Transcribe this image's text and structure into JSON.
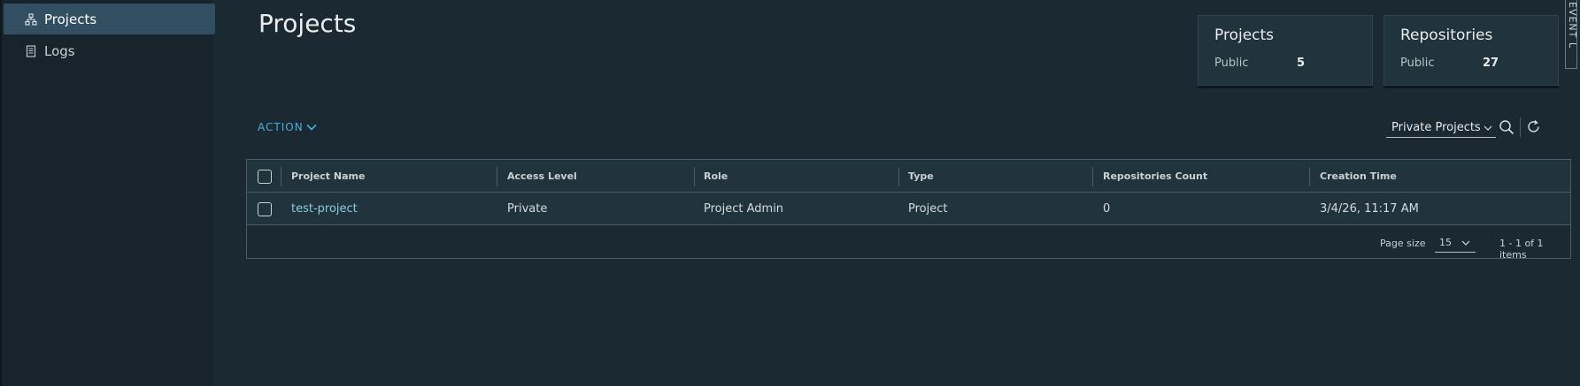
{
  "sidebar": {
    "items": [
      {
        "label": "Projects",
        "icon": "org-chart-icon"
      },
      {
        "label": "Logs",
        "icon": "log-icon"
      }
    ]
  },
  "page": {
    "title": "Projects"
  },
  "summary": {
    "projects": {
      "title": "Projects",
      "label": "Public",
      "value": "5"
    },
    "repositories": {
      "title": "Repositories",
      "label": "Public",
      "value": "27"
    }
  },
  "event_tab": {
    "label": "EVENT L"
  },
  "toolbar": {
    "action_label": "ACTION",
    "filter_value": "Private Projects"
  },
  "table": {
    "columns": [
      "Project Name",
      "Access Level",
      "Role",
      "Type",
      "Repositories Count",
      "Creation Time"
    ],
    "rows": [
      [
        "test-project",
        "Private",
        "Project Admin",
        "Project",
        "0",
        "3/4/26, 11:17 AM"
      ]
    ]
  },
  "footer": {
    "page_size_label": "Page size",
    "page_size_value": "15",
    "items_count": "1 - 1 of 1 items"
  },
  "colors": {
    "accent": "#49afd9",
    "link": "#89cbdf",
    "background": "#1b2a32",
    "sidebar_active": "#324f61"
  }
}
